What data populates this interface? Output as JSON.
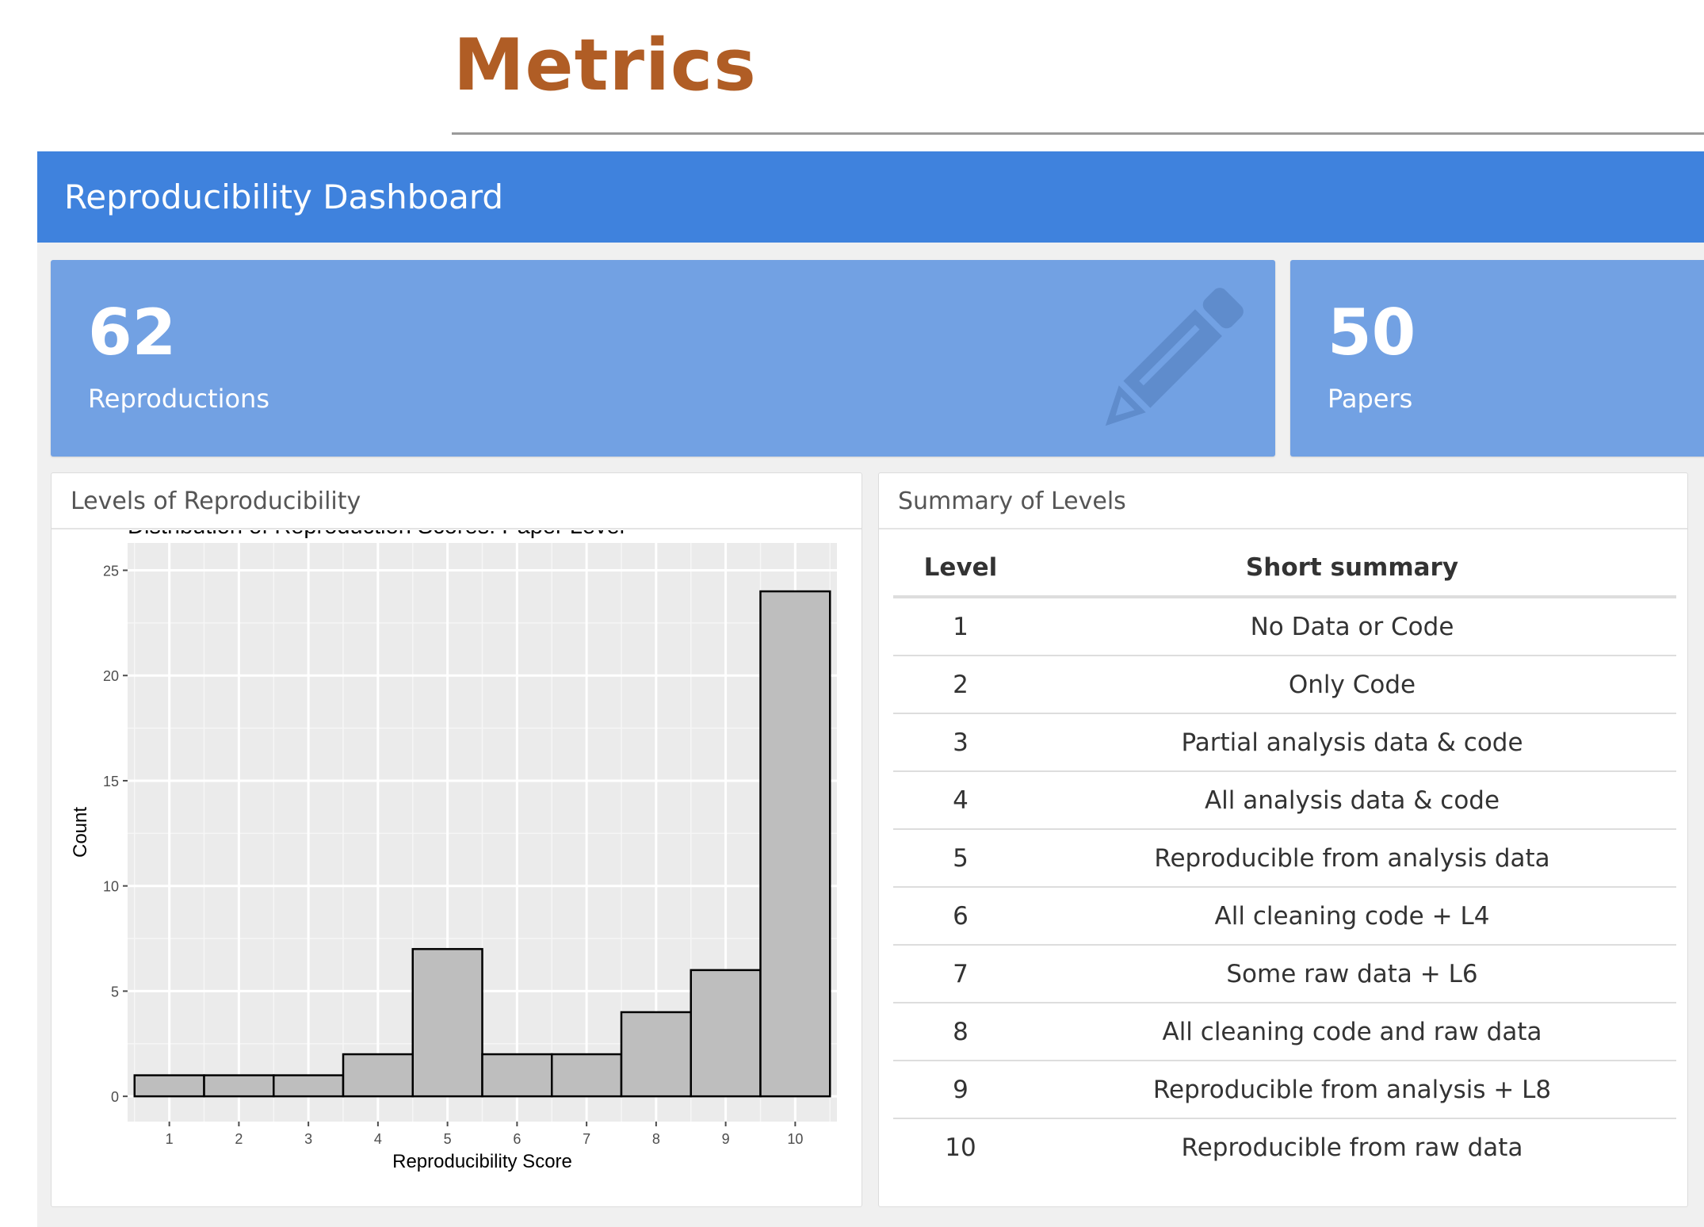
{
  "page": {
    "title": "Metrics"
  },
  "dashboard": {
    "title": "Reproducibility Dashboard"
  },
  "value_boxes": [
    {
      "value": "62",
      "label": "Reproductions",
      "icon": "pencil-icon"
    },
    {
      "value": "50",
      "label": "Papers"
    }
  ],
  "panels": {
    "levels": {
      "title": "Levels of Reproducibility"
    },
    "summary": {
      "title": "Summary of Levels"
    }
  },
  "summary_table": {
    "headers": [
      "Level",
      "Short summary"
    ],
    "rows": [
      [
        "1",
        "No Data or Code"
      ],
      [
        "2",
        "Only Code"
      ],
      [
        "3",
        "Partial analysis data & code"
      ],
      [
        "4",
        "All analysis data & code"
      ],
      [
        "5",
        "Reproducible from analysis data"
      ],
      [
        "6",
        "All cleaning code + L4"
      ],
      [
        "7",
        "Some raw data + L6"
      ],
      [
        "8",
        "All cleaning code and raw data"
      ],
      [
        "9",
        "Reproducible from analysis + L8"
      ],
      [
        "10",
        "Reproducible from raw data"
      ]
    ]
  },
  "colors": {
    "accent": "#3f82dd",
    "value_box": "#72a1e3",
    "title": "#b05d25",
    "bar_fill": "#bebebe",
    "panel_bg": "#ebebeb"
  },
  "chart_data": {
    "type": "bar",
    "title": "Distribution of Reproduction Scores: Paper Level",
    "xlabel": "Reproducibility Score",
    "ylabel": "Count",
    "categories": [
      "1",
      "2",
      "3",
      "4",
      "5",
      "6",
      "7",
      "8",
      "9",
      "10"
    ],
    "values": [
      1,
      1,
      1,
      2,
      7,
      2,
      2,
      4,
      6,
      24
    ],
    "yticks": [
      "0",
      "5",
      "10",
      "15",
      "20",
      "25"
    ],
    "ylim": [
      -1.2,
      26.3
    ],
    "grid": true
  }
}
